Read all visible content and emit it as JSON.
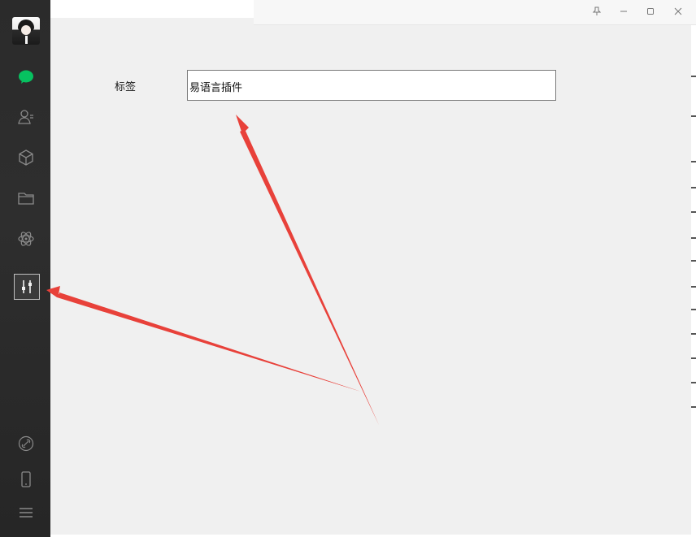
{
  "window": {
    "title": "",
    "controls": [
      "pin",
      "minimize",
      "maximize",
      "close"
    ]
  },
  "sidebar": {
    "avatar": "avatar",
    "items": [
      {
        "icon": "chat-icon",
        "active": true,
        "color": "#07c160"
      },
      {
        "icon": "contacts-icon"
      },
      {
        "icon": "cube-icon"
      },
      {
        "icon": "folder-icon"
      },
      {
        "icon": "atom-icon"
      },
      {
        "icon": "sliders-icon",
        "selected": true
      }
    ],
    "bottom": [
      {
        "icon": "link-icon"
      },
      {
        "icon": "phone-icon"
      },
      {
        "icon": "menu-icon"
      }
    ]
  },
  "form": {
    "label": "标签",
    "field_value": "易语言插件"
  },
  "annotations": {
    "arrow_color": "#e8413a"
  }
}
